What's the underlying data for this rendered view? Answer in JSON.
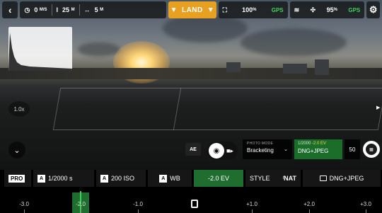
{
  "top_bar": {
    "back_icon": "chevron-left-icon",
    "speed_value": "0",
    "speed_unit": "M/S",
    "altitude_value": "25",
    "altitude_unit": "M",
    "distance_value": "5",
    "distance_unit": "M",
    "land_label": "LAND",
    "battery_percent": "100",
    "battery_unit": "%",
    "gps_label_1": "GPS",
    "signal_percent": "95",
    "signal_unit": "%",
    "gps_label_2": "GPS",
    "accent_color": "#e8a020"
  },
  "overlay": {
    "zoom_level": "1.0x",
    "ae_label": "AE",
    "photo_mode_caption": "PHOTO MODE",
    "photo_mode_value": "Bracketing",
    "exposure_info": "1/2000",
    "exposure_ev": "-2.0 EV",
    "file_format": "DNG+JPEG",
    "shot_count": "50"
  },
  "params": {
    "pro_label": "PRO",
    "shutter_tag": "A",
    "shutter_value": "1/2000 s",
    "iso_tag": "A",
    "iso_value": "200 ISO",
    "wb_tag": "A",
    "wb_value": "WB",
    "ev_value": "-2.0 EV",
    "style_label": "STYLE",
    "style_value": "NAT",
    "format_value": "DNG+JPEG",
    "active_color": "#1f6e2f"
  },
  "ev_scale": {
    "labels": [
      "-3.0",
      "-2.0",
      "-1.0",
      "0",
      "+1.0",
      "+2.0",
      "+3.0"
    ],
    "current_value": -2.0
  }
}
